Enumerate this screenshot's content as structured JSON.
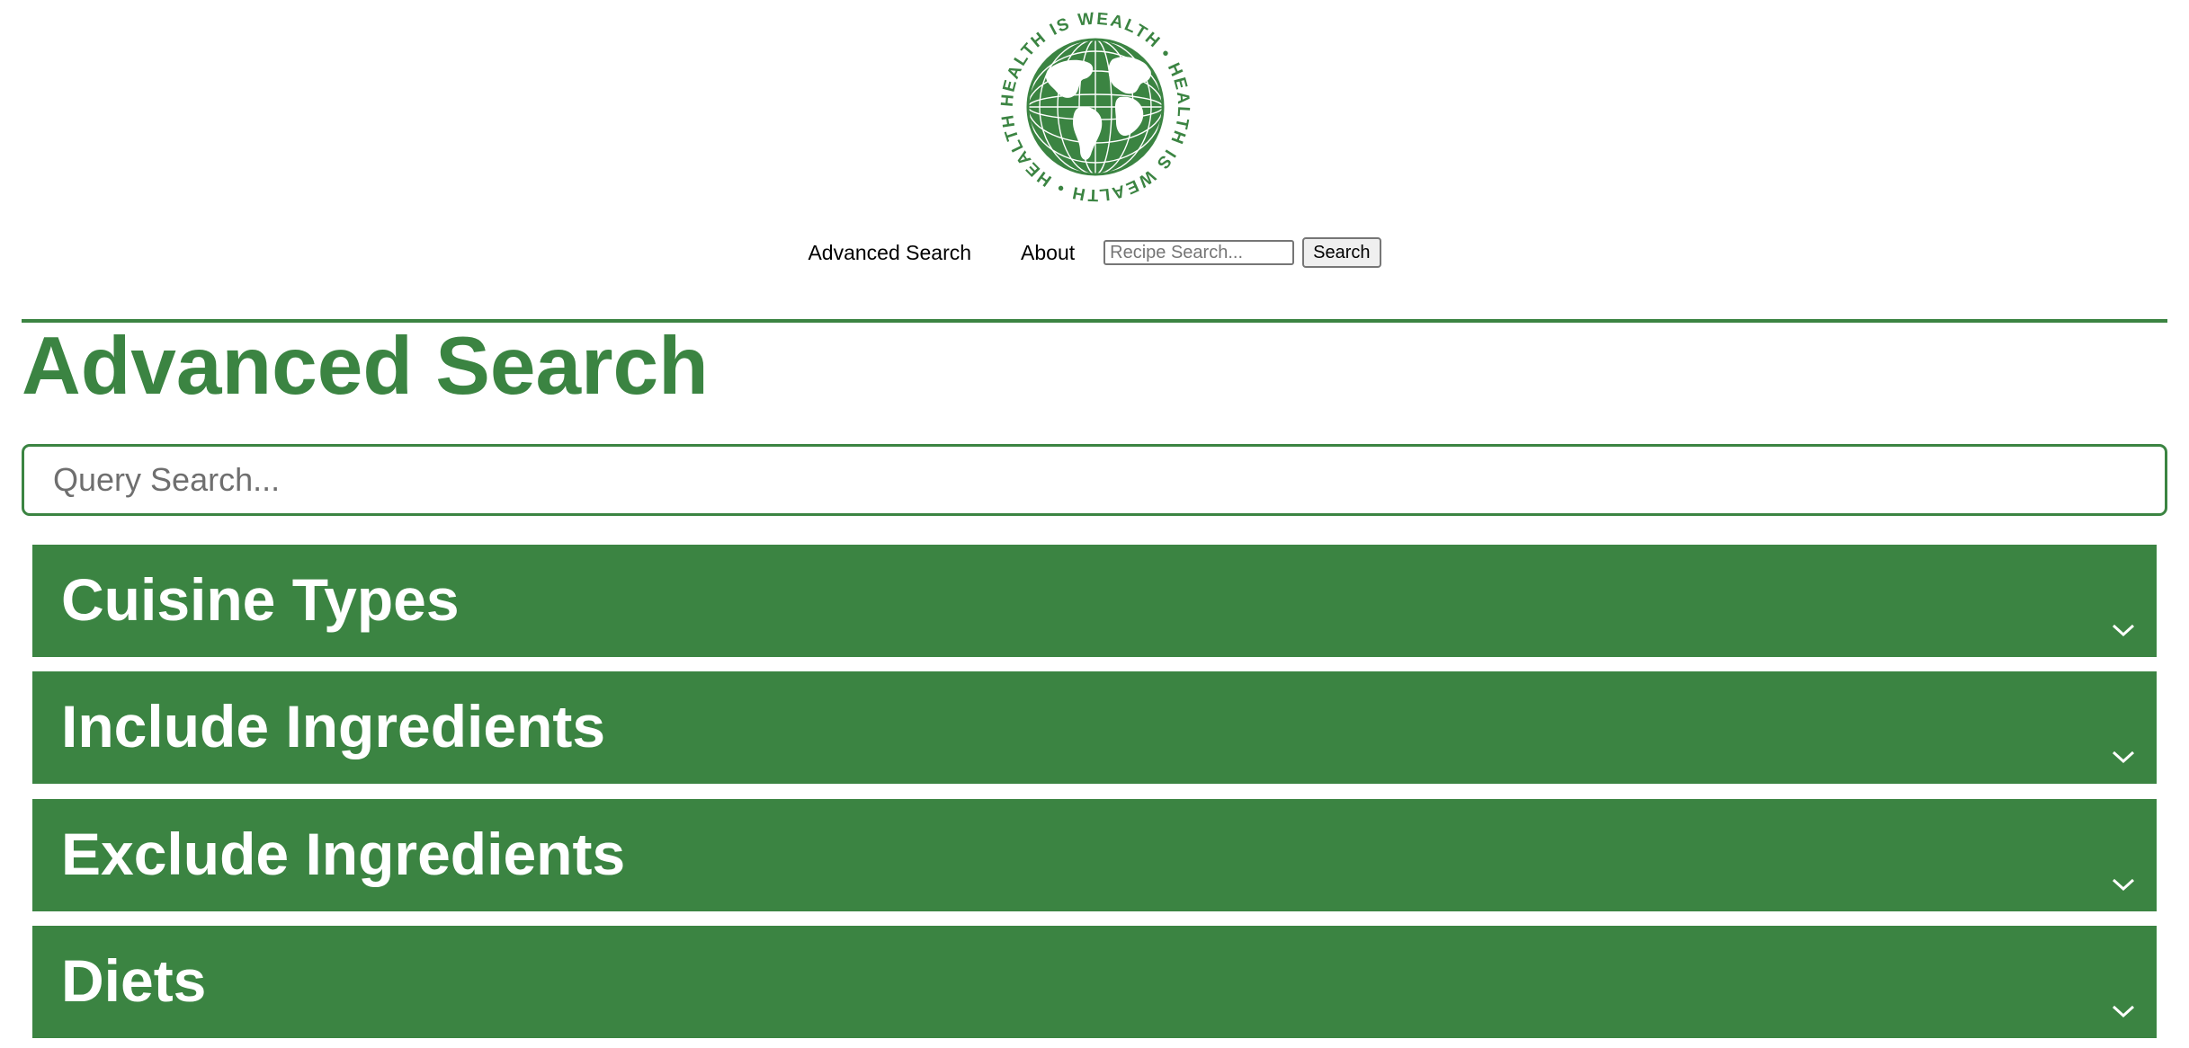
{
  "logo": {
    "ring_text": "HEALTH IS WEALTH • HEALTH IS WEALTH • HEALTH IS WEALTH •",
    "icon": "globe-icon",
    "color": "#3b8442"
  },
  "nav": {
    "advanced_search": "Advanced Search",
    "about": "About",
    "search_placeholder": "Recipe Search...",
    "search_value": "",
    "search_button": "Search"
  },
  "page": {
    "title": "Advanced Search",
    "query_placeholder": "Query Search...",
    "query_value": ""
  },
  "sections": [
    {
      "label": "Cuisine Types",
      "icon": "chevron-down-icon",
      "expanded": false
    },
    {
      "label": "Include Ingredients",
      "icon": "chevron-down-icon",
      "expanded": false
    },
    {
      "label": "Exclude Ingredients",
      "icon": "chevron-down-icon",
      "expanded": false
    },
    {
      "label": "Diets",
      "icon": "chevron-down-icon",
      "expanded": false
    }
  ],
  "colors": {
    "brand_green": "#3b8442",
    "background": "#ffffff",
    "section_text": "#ffffff"
  }
}
